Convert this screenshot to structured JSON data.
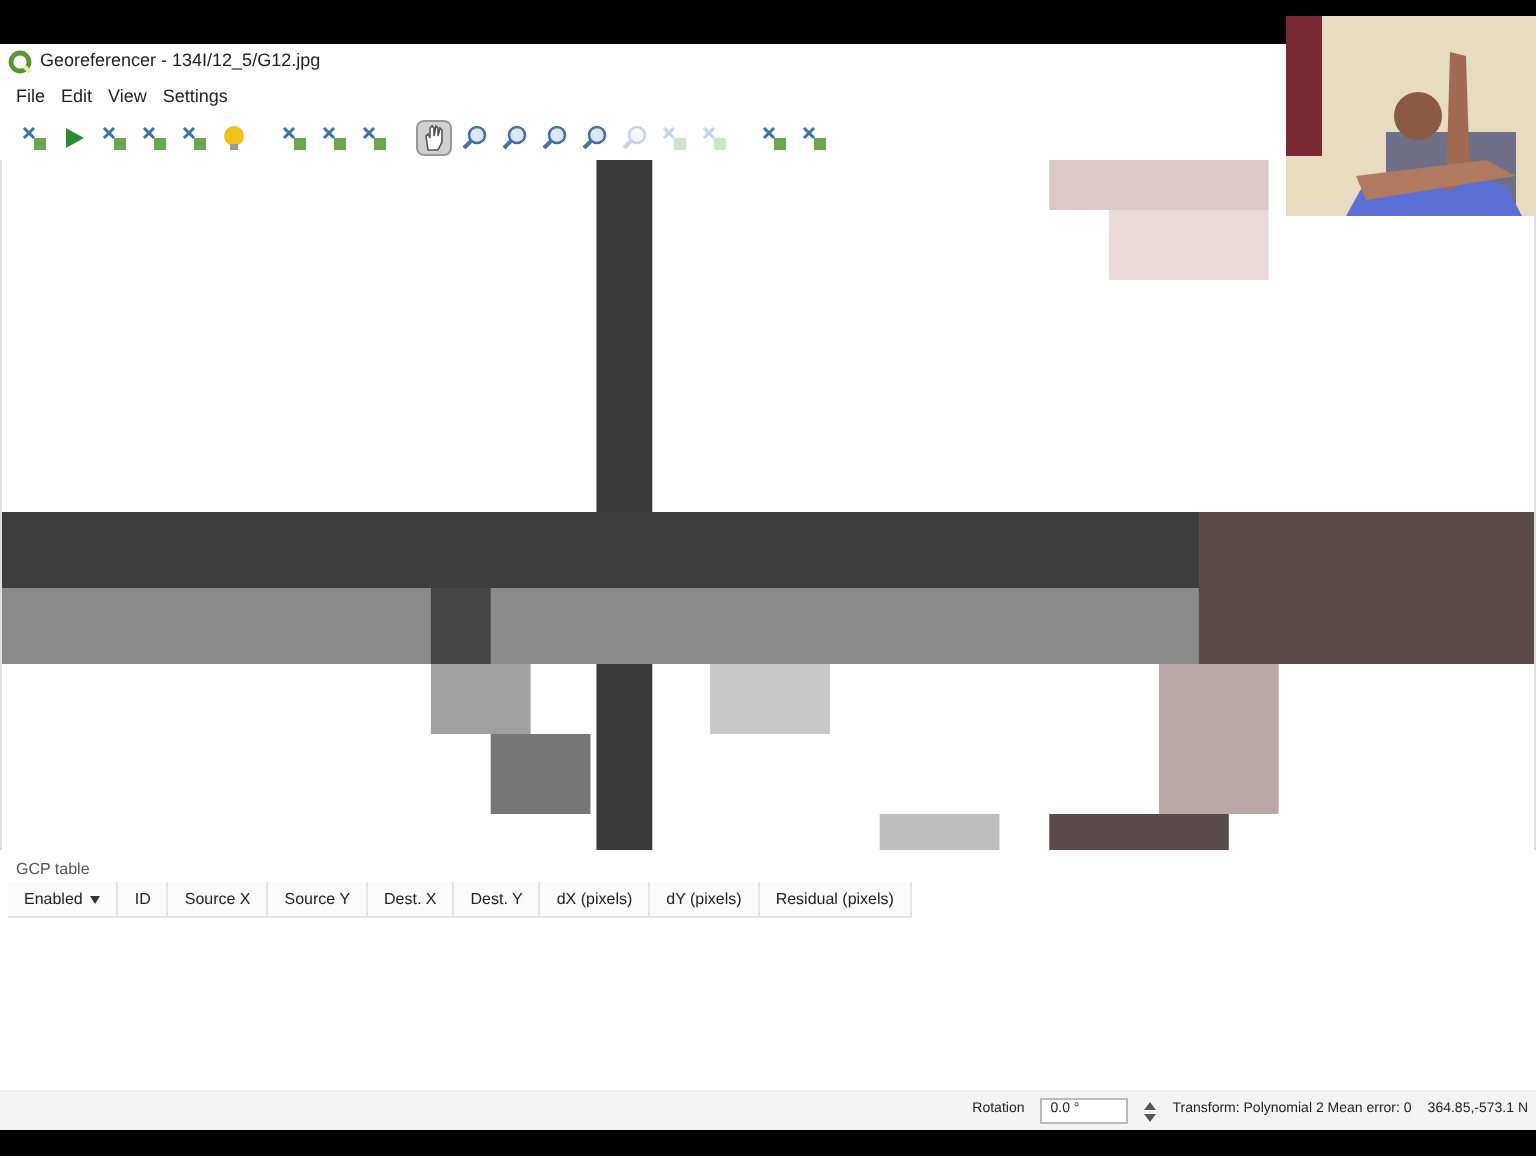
{
  "window": {
    "title": "Georeferencer - 134I/12_5/G12.jpg"
  },
  "menu": [
    "File",
    "Edit",
    "View",
    "Settings"
  ],
  "toolbar": [
    {
      "kind": "tool"
    },
    {
      "kind": "play"
    },
    {
      "kind": "tool"
    },
    {
      "kind": "tool"
    },
    {
      "kind": "tool"
    },
    {
      "kind": "dot"
    },
    {
      "kind": "sep"
    },
    {
      "kind": "tool"
    },
    {
      "kind": "tool"
    },
    {
      "kind": "tool"
    },
    {
      "kind": "sep"
    },
    {
      "kind": "pan",
      "selected": true
    },
    {
      "kind": "zoom"
    },
    {
      "kind": "zoom"
    },
    {
      "kind": "zoom"
    },
    {
      "kind": "zoom"
    },
    {
      "kind": "zoom",
      "disabled": true
    },
    {
      "kind": "tool",
      "disabled": true
    },
    {
      "kind": "tool",
      "disabled": true
    },
    {
      "kind": "sep"
    },
    {
      "kind": "tool"
    },
    {
      "kind": "tool"
    }
  ],
  "gcp_table": {
    "title": "GCP table",
    "columns": [
      "Enabled",
      "ID",
      "Source X",
      "Source Y",
      "Dest. X",
      "Dest. Y",
      "dX (pixels)",
      "dY (pixels)",
      "Residual (pixels)"
    ]
  },
  "status_bar": {
    "rotation_label": "Rotation",
    "rotation_value": "0.0 °",
    "transform": "Transform: Polynomial 2 Mean error: 0",
    "coordinates": "364.85,-573.1 N"
  }
}
